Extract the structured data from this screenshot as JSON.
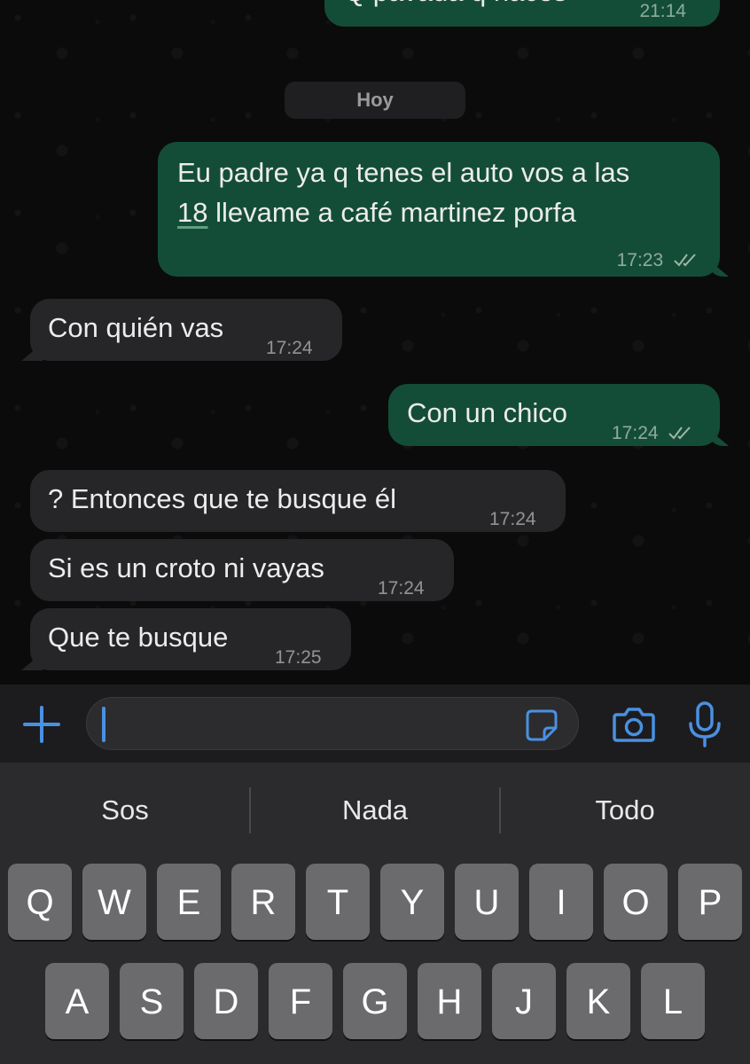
{
  "chat": {
    "previous_message": {
      "text": "Q pavada q haces",
      "time": "21:14"
    },
    "day_label": "Hoy",
    "messages": [
      {
        "direction": "out",
        "line1": "Eu padre ya q tenes el auto vos a las",
        "line2_num": "18",
        "line2_rest": " llevame a café martinez porfa",
        "time": "17:23"
      },
      {
        "direction": "in",
        "text": "Con quién vas",
        "time": "17:24"
      },
      {
        "direction": "out",
        "text": "Con un chico",
        "time": "17:24"
      },
      {
        "direction": "in",
        "text": "? Entonces que te busque él",
        "time": "17:24"
      },
      {
        "direction": "in",
        "text": "Si es un croto ni vayas",
        "time": "17:24"
      },
      {
        "direction": "in",
        "text": "Que te busque",
        "time": "17:25"
      }
    ]
  },
  "input_bar": {
    "plus_icon": "plus-icon",
    "sticker_icon": "sticker-icon",
    "camera_icon": "camera-icon",
    "mic_icon": "microphone-icon",
    "accent_color": "#4a90e2"
  },
  "keyboard": {
    "suggestions": [
      "Sos",
      "Nada",
      "Todo"
    ],
    "row1": [
      "Q",
      "W",
      "E",
      "R",
      "T",
      "Y",
      "U",
      "I",
      "O",
      "P"
    ],
    "row2": [
      "A",
      "S",
      "D",
      "F",
      "G",
      "H",
      "J",
      "K",
      "L"
    ]
  },
  "colors": {
    "outgoing_bubble": "#144d37",
    "incoming_bubble": "#262628",
    "chat_background": "#0b0b0b"
  }
}
